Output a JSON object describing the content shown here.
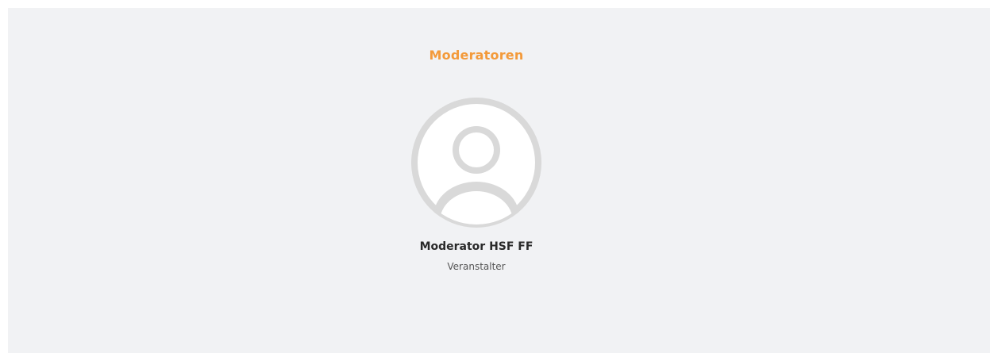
{
  "section": {
    "title": "Moderatoren",
    "title_color": "#f39a3a"
  },
  "moderators": [
    {
      "name": "Moderator HSF FF",
      "role": "Veranstalter",
      "avatar_icon": "user-placeholder-icon"
    }
  ]
}
